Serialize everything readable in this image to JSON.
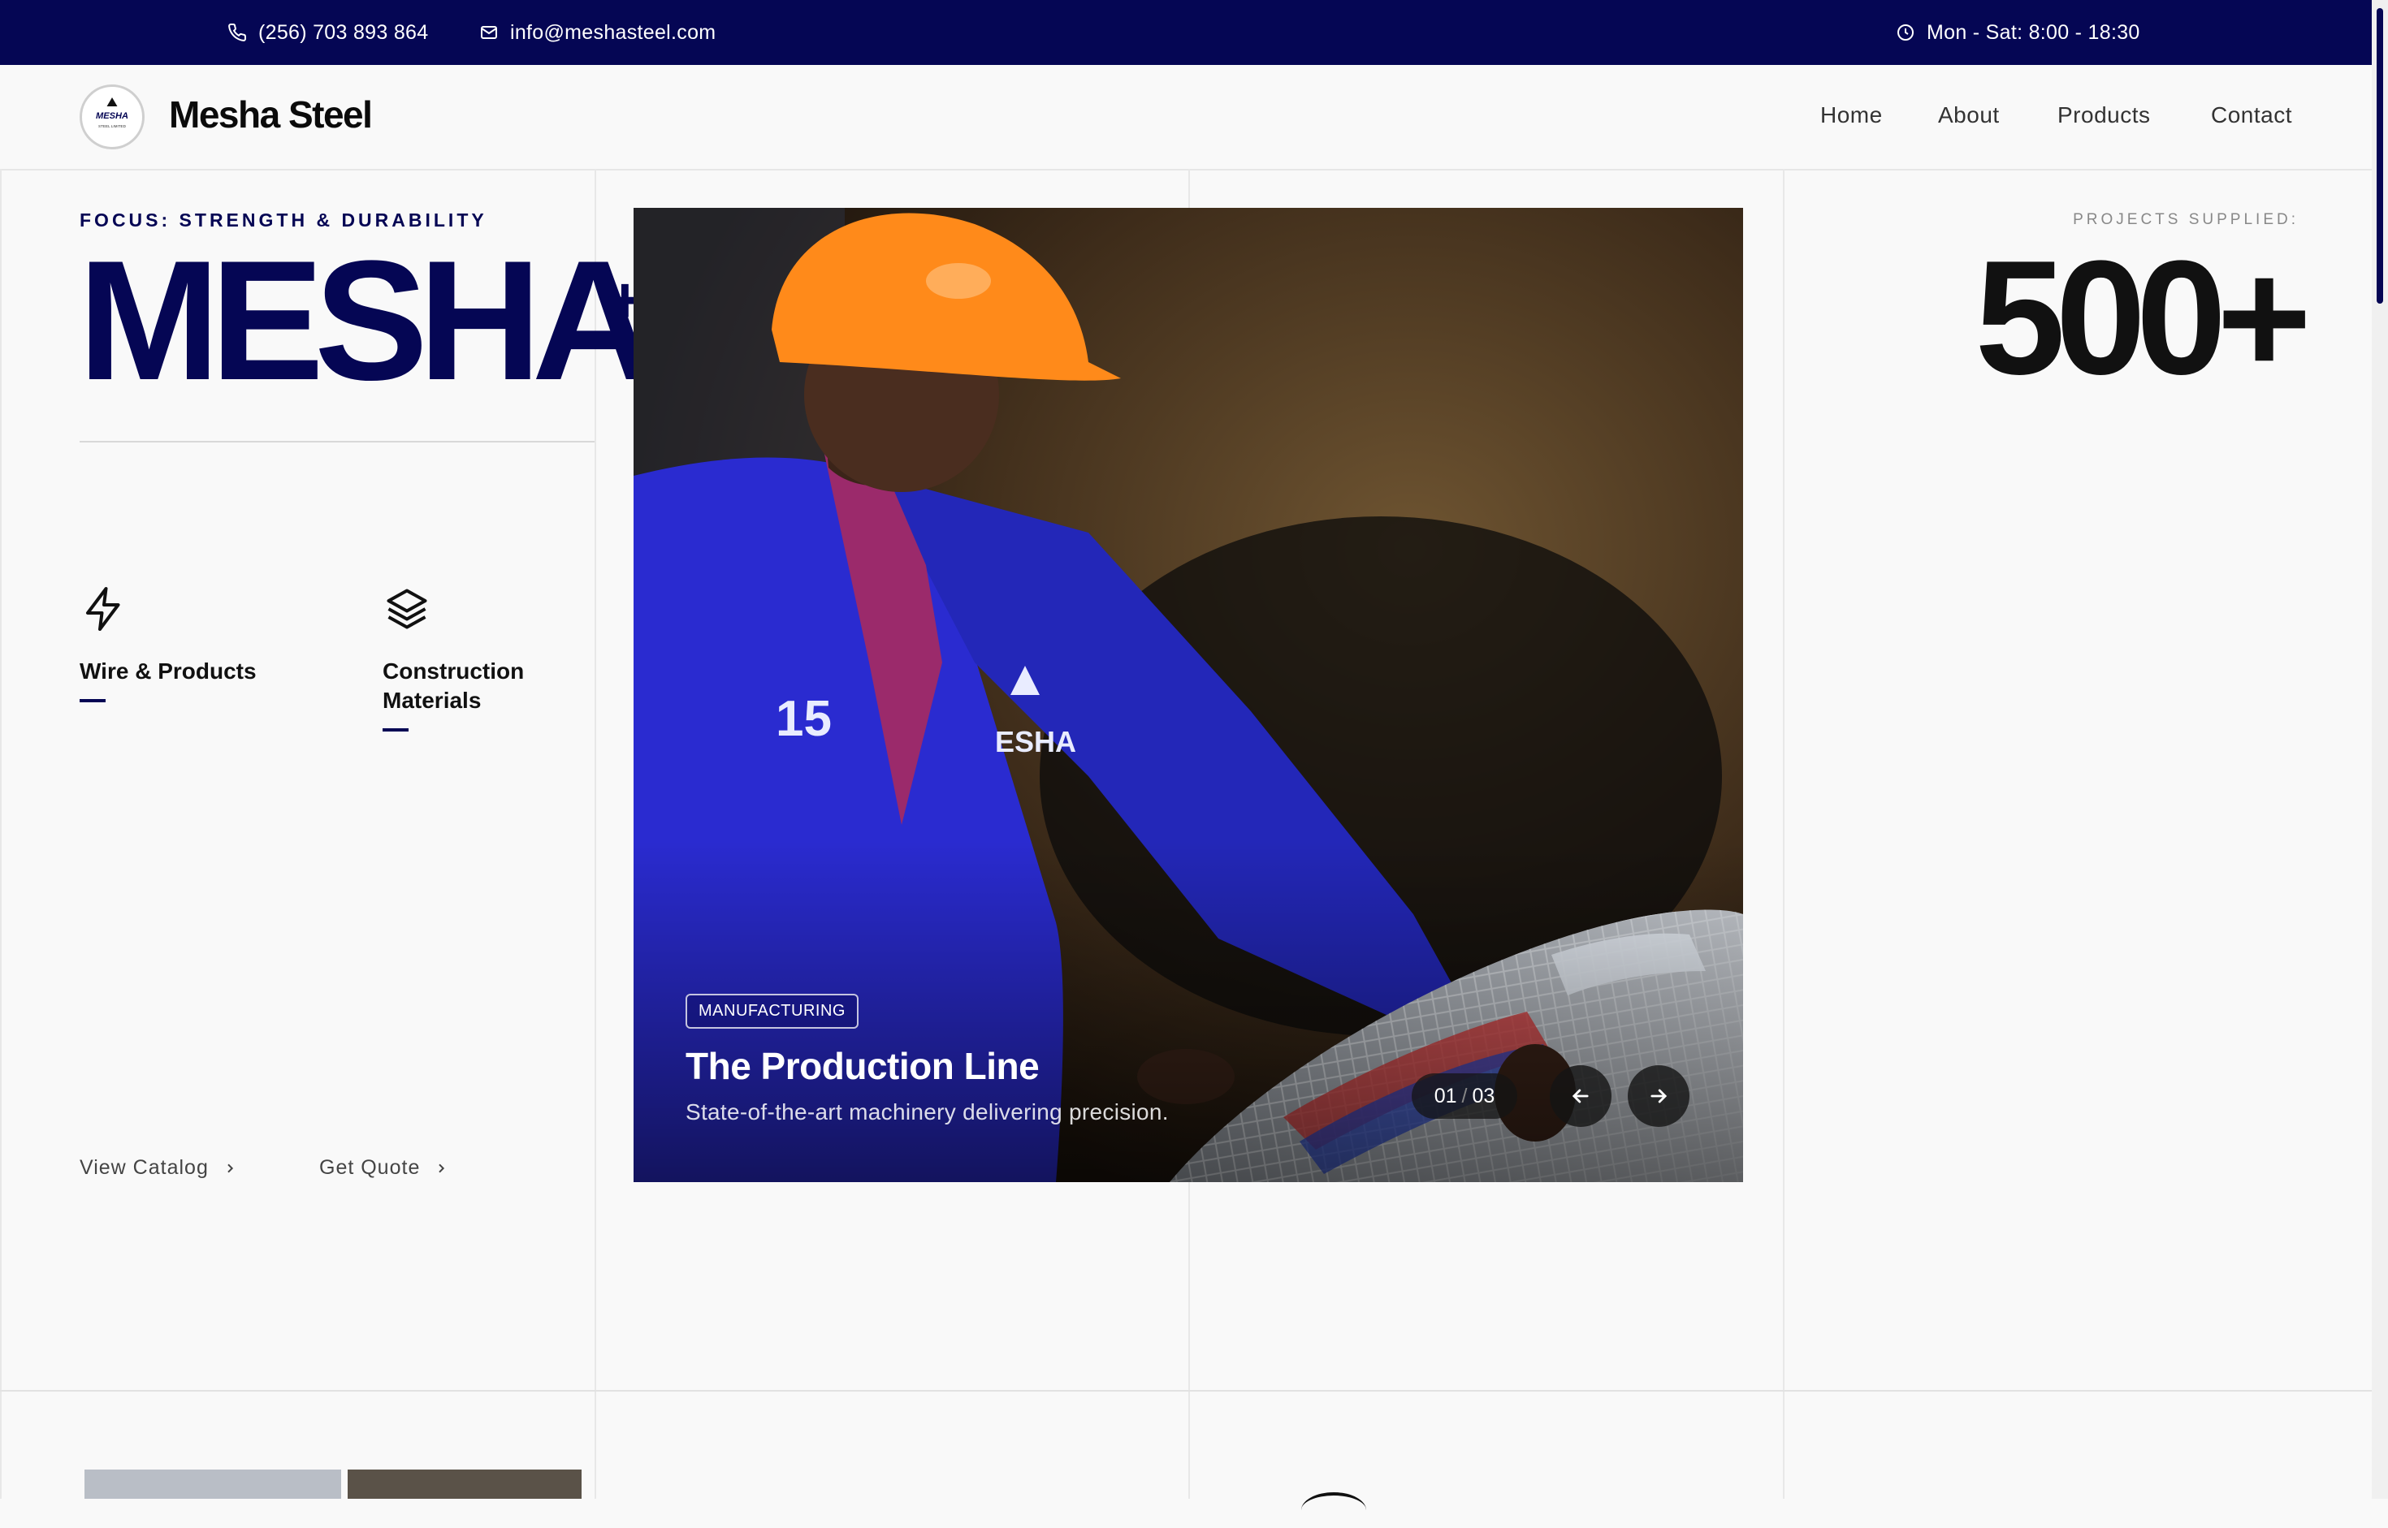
{
  "topbar": {
    "phone": "(256) 703 893 864",
    "email": "info@meshasteel.com",
    "hours": "Mon - Sat: 8:00 - 18:30"
  },
  "header": {
    "logo_text": "MESHA",
    "logo_subtext": "STEEL LIMITED",
    "brand": "Mesha Steel",
    "nav": [
      "Home",
      "About",
      "Products",
      "Contact"
    ]
  },
  "hero_left": {
    "focus": "FOCUS: STRENGTH & DURABILITY",
    "headline": "MESHA",
    "headline_sup": "+",
    "features": [
      {
        "label": "Wire & Products",
        "icon": "lightning-icon"
      },
      {
        "label": "Construction Materials",
        "icon": "layers-icon"
      }
    ],
    "links": [
      "View Catalog",
      "Get Quote"
    ]
  },
  "slider": {
    "tag": "MANUFACTURING",
    "title": "The Production Line",
    "subtitle": "State-of-the-art machinery delivering precision.",
    "current": "01",
    "separator": "/",
    "total": "03",
    "worker_number": "15",
    "worker_logo": "ESHA"
  },
  "stats": {
    "label": "PROJECTS SUPPLIED:",
    "value": "500+"
  },
  "colors": {
    "brand_navy": "#050654",
    "hardhat_orange": "#ff8a1a",
    "uniform_blue": "#2a2bd0"
  }
}
